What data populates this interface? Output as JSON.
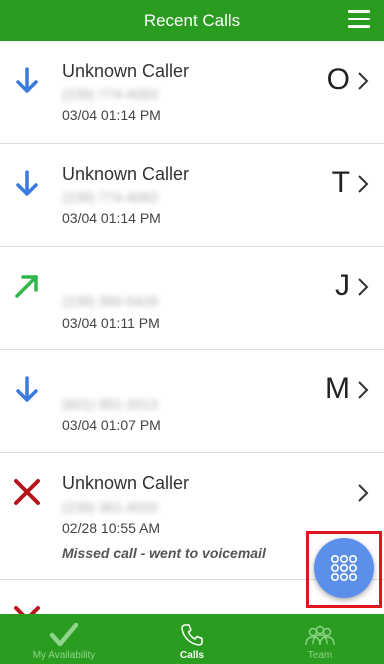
{
  "header": {
    "title": "Recent Calls",
    "menu_icon": "hamburger-icon"
  },
  "calls": [
    {
      "direction": "incoming",
      "icon": "arrow-down-icon",
      "name": "Unknown Caller",
      "number": "(239) 774-4083",
      "datetime": "03/04 01:14 PM",
      "initial": "O"
    },
    {
      "direction": "incoming",
      "icon": "arrow-down-icon",
      "name": "Unknown Caller",
      "number": "(239) 774-4083",
      "datetime": "03/04 01:14 PM",
      "initial": "T"
    },
    {
      "direction": "outgoing",
      "icon": "arrow-up-right-icon",
      "name": "",
      "number": "(239) 390-5426",
      "datetime": "03/04 01:11 PM",
      "initial": "J"
    },
    {
      "direction": "incoming",
      "icon": "arrow-down-icon",
      "name": "",
      "number": "(601) 951-2013",
      "datetime": "03/04 01:07 PM",
      "initial": "M"
    },
    {
      "direction": "missed",
      "icon": "x-icon",
      "name": "Unknown Caller",
      "number": "(239) 361-4020",
      "datetime": "02/28 10:55 AM",
      "initial": "",
      "note": "Missed call - went to voicemail"
    }
  ],
  "tabs": [
    {
      "label": "My Availability",
      "icon": "checkmark-icon",
      "active": false
    },
    {
      "label": "Calls",
      "icon": "phone-icon",
      "active": true
    },
    {
      "label": "Team",
      "icon": "team-icon",
      "active": false
    }
  ],
  "colors": {
    "brand_green": "#2a9c1f",
    "incoming_blue": "#3b7be0",
    "outgoing_green": "#2fb84a",
    "missed_red": "#b5151b",
    "fab_blue": "#5b8fea",
    "highlight_red": "#e2141e"
  }
}
